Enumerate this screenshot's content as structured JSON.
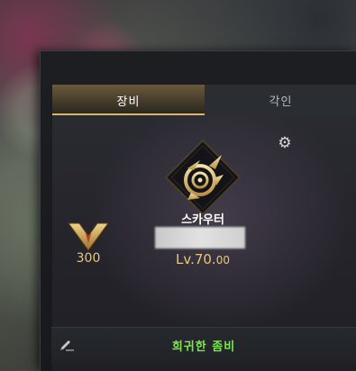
{
  "tabs": {
    "equipment": "장비",
    "engraving": "각인"
  },
  "character": {
    "class_name": "스카우터",
    "level_int": "Lv.70.",
    "level_dec": "00",
    "rank_value": "300"
  },
  "footer": {
    "title": "희귀한 좀비"
  },
  "icons": {
    "settings": "gear-icon",
    "edit": "pencil-icon",
    "class": "scouter-class-emblem-icon",
    "rank": "chevron-rank-icon"
  },
  "colors": {
    "accent_gold": "#e9c77a",
    "title_green": "#7ee64f",
    "tab_active_line": "#d9b76a"
  }
}
